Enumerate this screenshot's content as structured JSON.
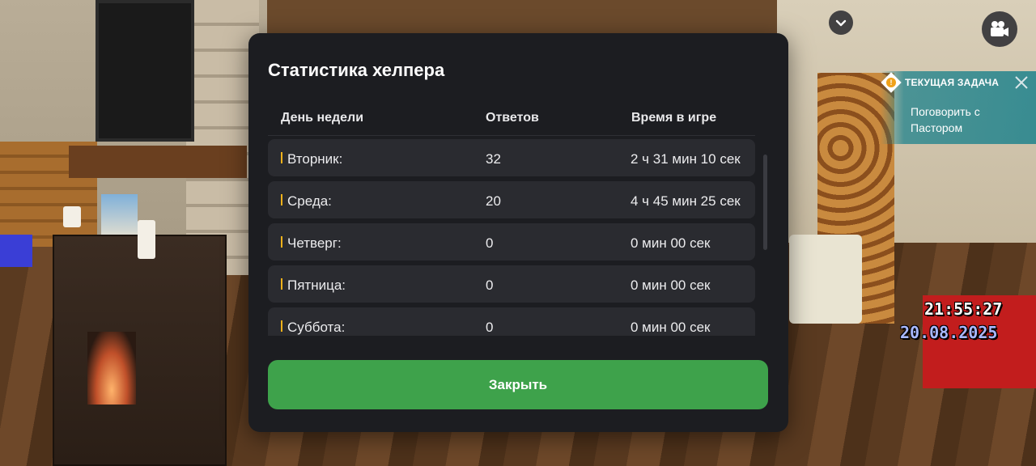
{
  "modal": {
    "title": "Статистика хелпера",
    "columns": [
      "День недели",
      "Ответов",
      "Время в игре"
    ],
    "rows": [
      {
        "day": "Вторник:",
        "answers": "32",
        "time": "2 ч 31 мин 10 сек"
      },
      {
        "day": "Среда:",
        "answers": "20",
        "time": "4 ч 45 мин 25 сек"
      },
      {
        "day": "Четверг:",
        "answers": "0",
        "time": "0 мин 00 сек"
      },
      {
        "day": "Пятница:",
        "answers": "0",
        "time": "0 мин 00 сек"
      },
      {
        "day": "Суббота:",
        "answers": "0",
        "time": "0 мин 00 сек"
      }
    ],
    "close_label": "Закрыть"
  },
  "hud": {
    "task_header": "ТЕКУЩАЯ ЗАДАЧА",
    "task_text": "Поговорить с Пастором",
    "time": "21:55:27",
    "date": "20.08.2025",
    "icons": [
      "chevron-down-icon",
      "video-camera-icon",
      "task-alert-icon",
      "close-icon"
    ]
  },
  "colors": {
    "modal_bg": "#1c1d21",
    "row_bg": "#2a2b30",
    "accent_marker": "#f2b21b",
    "close_button": "#3ea24b",
    "task_panel": "#1e828c"
  }
}
